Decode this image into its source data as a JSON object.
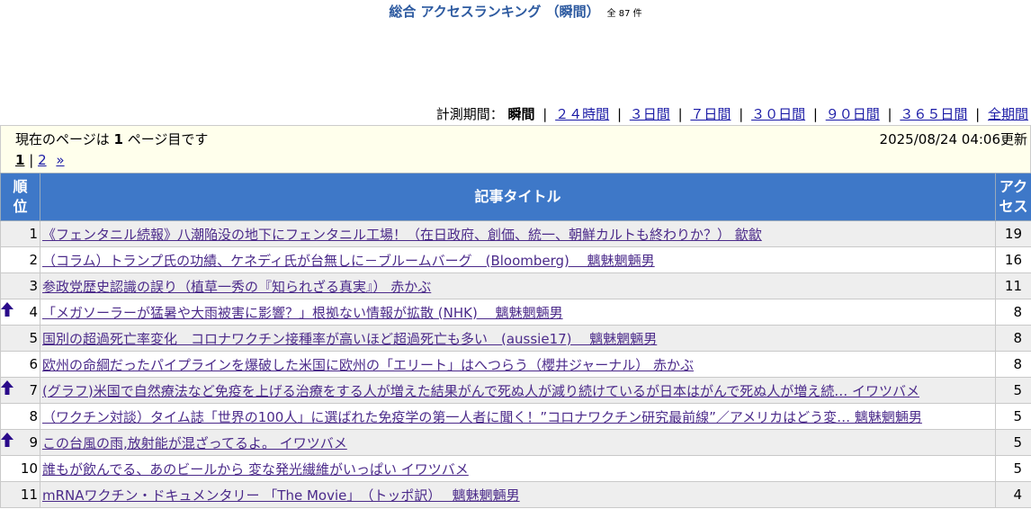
{
  "header": {
    "title": "総合 アクセスランキング （瞬間）",
    "count": "全 87 件"
  },
  "period": {
    "label": "計測期間：",
    "current": "瞬間",
    "links": [
      "２４時間",
      "３日間",
      "７日間",
      "３０日間",
      "９０日間",
      "３６５日間",
      "全期間"
    ],
    "separator": "|"
  },
  "info": {
    "page_text_pre": "現在のページは",
    "page_number": "1",
    "page_text_post": "ページ目です",
    "updated": "2025/08/24 04:06更新"
  },
  "pager": {
    "current": "1",
    "sep": "|",
    "next_page": "2",
    "next_arrow": "»"
  },
  "table": {
    "col_rank": "順位",
    "col_title": "記事タイトル",
    "col_access": "アクセス",
    "rows": [
      {
        "rank": "1",
        "title": "《フェンタニル続報》八潮陥没の地下にフェンタニル工場！（在日政府、創価、統一、朝鮮カルトも終わりか？） 歙歙",
        "count": "19",
        "up": false
      },
      {
        "rank": "2",
        "title": "（コラム）トランプ氏の功績、ケネディ氏が台無しに－ブルームバーグ　(Bloomberg)　 魑魅魍魎男",
        "count": "16",
        "up": false
      },
      {
        "rank": "3",
        "title": "参政党歴史認識の誤り（植草一秀の『知られざる真実』） 赤かぶ",
        "count": "11",
        "up": false
      },
      {
        "rank": "4",
        "title": "「メガソーラーが猛暑や大雨被害に影響？」根拠ない情報が拡散 (NHK)　 魑魅魍魎男",
        "count": "8",
        "up": true
      },
      {
        "rank": "5",
        "title": "国別の超過死亡率変化　コロナワクチン接種率が高いほど超過死亡も多い　(aussie17)　 魑魅魍魎男",
        "count": "8",
        "up": false
      },
      {
        "rank": "6",
        "title": "欧州の命綱だったパイプラインを爆破した米国に欧州の「エリート」はへつらう（櫻井ジャーナル） 赤かぶ",
        "count": "8",
        "up": false
      },
      {
        "rank": "7",
        "title": "(グラフ)米国で自然療法など免疫を上げる治療をする人が増えた結果がんで死ぬ人が減り続けているが日本はがんで死ぬ人が増え続… イワツバメ",
        "count": "5",
        "up": true
      },
      {
        "rank": "8",
        "title": "（ワクチン対談）タイム誌「世界の100人」に選ばれた免疫学の第一人者に聞く！”コロナワクチン研究最前線”／アメリカはどう変… 魑魅魍魎男",
        "count": "5",
        "up": false
      },
      {
        "rank": "9",
        "title": "この台風の雨,放射能が混ざってるよ。 イワツバメ",
        "count": "5",
        "up": true
      },
      {
        "rank": "10",
        "title": "誰もが飲んでる、あのビールから 変な発光繊維がいっぱい イワツバメ",
        "count": "5",
        "up": false
      },
      {
        "rank": "11",
        "title": "mRNAワクチン・ドキュメンタリー 「The Movie」　（トッポ訳）　 魑魅魍魎男",
        "count": "4",
        "up": false
      }
    ]
  },
  "colors": {
    "header_bg": "#3e78c8",
    "title_color": "#2d5aa0",
    "link_color": "#4b2a8a",
    "up_arrow": "#2a0a8a",
    "info_bg": "#ffffec"
  },
  "icons": {
    "up": "up-arrow-icon"
  }
}
